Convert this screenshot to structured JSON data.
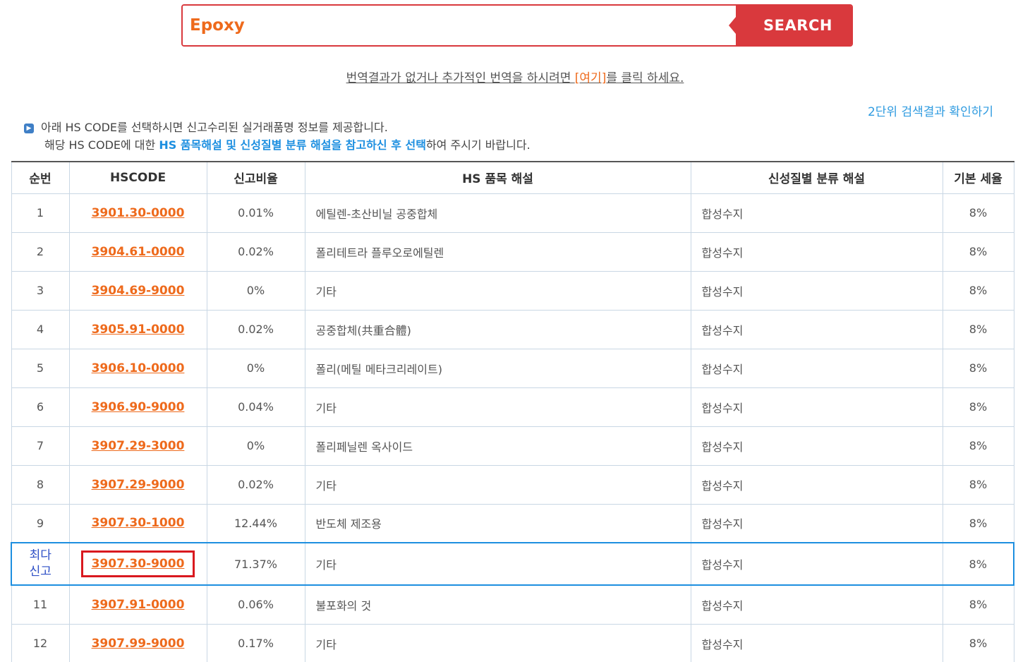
{
  "search": {
    "value": "Epoxy",
    "button_label": "SEARCH"
  },
  "translate_hint": {
    "before": "번역결과가 없거나 추가적인 번역을 하시려면 ",
    "link": "[여기]",
    "after": "를 클릭 하세요."
  },
  "two_digit_link": "2단위 검색결과 확인하기",
  "notice": {
    "line1": "아래 HS CODE를 선택하시면 신고수리된 실거래품명 정보를 제공합니다.",
    "line2_before": "해당 HS CODE에 대한 ",
    "line2_highlight": "HS 품목해설 및 신성질별 분류 해설을 참고하신 후 선택",
    "line2_after": "하여 주시기 바랍니다."
  },
  "table": {
    "headers": [
      "순번",
      "HSCODE",
      "신고비율",
      "HS 품목 해설",
      "신성질별 분류 해설",
      "기본 세율"
    ],
    "rows": [
      {
        "no": "1",
        "code": "3901.30-0000",
        "rate": "0.01%",
        "desc": "에틸렌-초산비닐 공중합체",
        "class": "합성수지",
        "tax": "8%"
      },
      {
        "no": "2",
        "code": "3904.61-0000",
        "rate": "0.02%",
        "desc": "폴리테트라 플루오로에틸렌",
        "class": "합성수지",
        "tax": "8%"
      },
      {
        "no": "3",
        "code": "3904.69-9000",
        "rate": "0%",
        "desc": "기타",
        "class": "합성수지",
        "tax": "8%"
      },
      {
        "no": "4",
        "code": "3905.91-0000",
        "rate": "0.02%",
        "desc": "공중합체(共重合體)",
        "class": "합성수지",
        "tax": "8%"
      },
      {
        "no": "5",
        "code": "3906.10-0000",
        "rate": "0%",
        "desc": "폴리(메틸 메타크리레이트)",
        "class": "합성수지",
        "tax": "8%"
      },
      {
        "no": "6",
        "code": "3906.90-9000",
        "rate": "0.04%",
        "desc": "기타",
        "class": "합성수지",
        "tax": "8%"
      },
      {
        "no": "7",
        "code": "3907.29-3000",
        "rate": "0%",
        "desc": "폴리페닐렌 옥사이드",
        "class": "합성수지",
        "tax": "8%"
      },
      {
        "no": "8",
        "code": "3907.29-9000",
        "rate": "0.02%",
        "desc": "기타",
        "class": "합성수지",
        "tax": "8%"
      },
      {
        "no": "9",
        "code": "3907.30-1000",
        "rate": "12.44%",
        "desc": "반도체 제조용",
        "class": "합성수지",
        "tax": "8%"
      },
      {
        "no_line1": "최다",
        "no_line2": "신고",
        "code": "3907.30-9000",
        "rate": "71.37%",
        "desc": "기타",
        "class": "합성수지",
        "tax": "8%"
      },
      {
        "no": "11",
        "code": "3907.91-0000",
        "rate": "0.06%",
        "desc": "불포화의 것",
        "class": "합성수지",
        "tax": "8%"
      },
      {
        "no": "12",
        "code": "3907.99-9000",
        "rate": "0.17%",
        "desc": "기타",
        "class": "합성수지",
        "tax": "8%"
      }
    ]
  }
}
